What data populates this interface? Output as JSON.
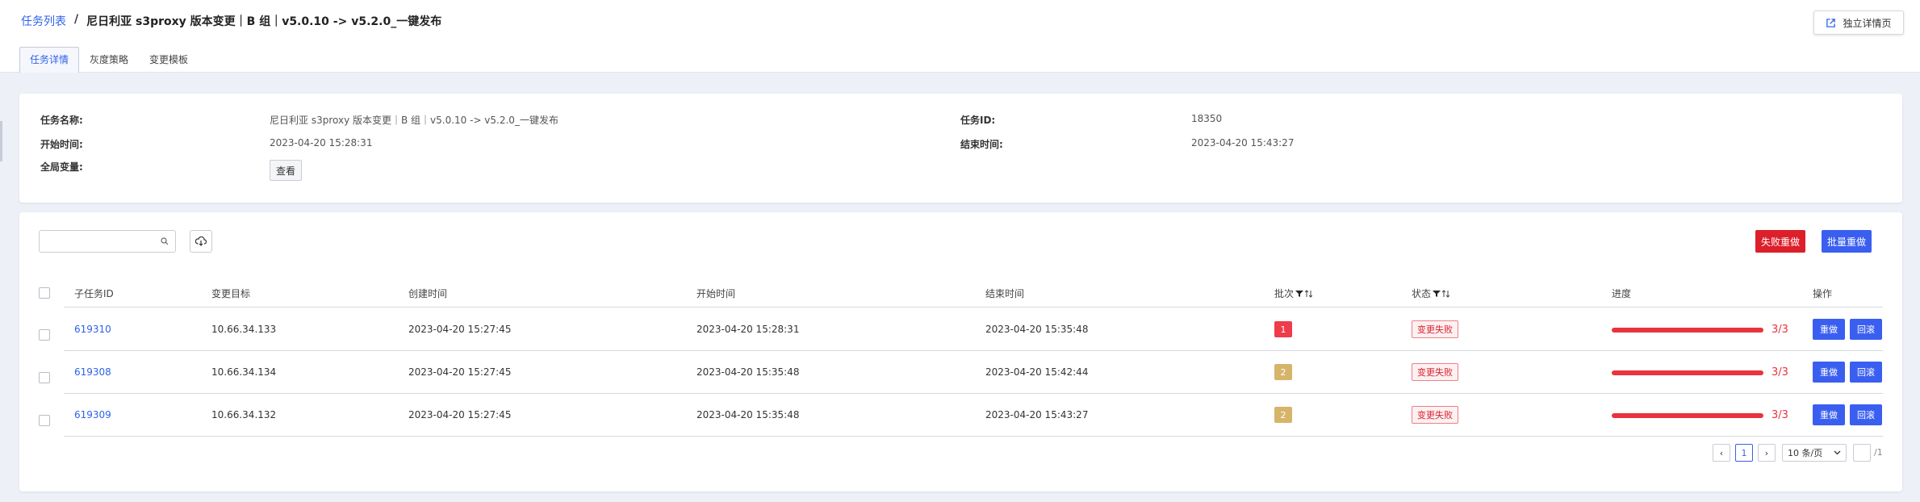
{
  "breadcrumb": {
    "root": "任务列表",
    "sep": "/",
    "current": "尼日利亚 s3proxy 版本变更｜B 组｜v5.0.10 -> v5.2.0_一键发布"
  },
  "header": {
    "standalone_label": "独立详情页"
  },
  "tabs": [
    {
      "label": "任务详情",
      "active": true
    },
    {
      "label": "灰度策略",
      "active": false
    },
    {
      "label": "变更模板",
      "active": false
    }
  ],
  "info": {
    "task_name_label": "任务名称:",
    "task_name_value": "尼日利亚 s3proxy 版本变更｜B 组｜v5.0.10 -> v5.2.0_一键发布",
    "task_id_label": "任务ID:",
    "task_id_value": "18350",
    "start_label": "开始时间:",
    "start_value": "2023-04-20 15:28:31",
    "end_label": "结束时间:",
    "end_value": "2023-04-20 15:43:27",
    "global_label": "全局变量:",
    "view_label": "查看"
  },
  "toolbar": {
    "search_placeholder": "",
    "retry_failed_label": "失败重做",
    "batch_retry_label": "批量重做"
  },
  "table": {
    "headers": {
      "subtask_id": "子任务ID",
      "target": "变更目标",
      "created": "创建时间",
      "start": "开始时间",
      "end": "结束时间",
      "batch": "批次",
      "status": "状态",
      "progress": "进度",
      "ops": "操作"
    },
    "rows": [
      {
        "id": "619310",
        "target": "10.66.34.133",
        "created": "2023-04-20 15:27:45",
        "start": "2023-04-20 15:28:31",
        "end": "2023-04-20 15:35:48",
        "batch": "1",
        "batch_color": "#ef3b4a",
        "status": "变更失败",
        "progress": 1.0,
        "progress_text": "3/3",
        "redo": "重做",
        "rollback": "回滚"
      },
      {
        "id": "619308",
        "target": "10.66.34.134",
        "created": "2023-04-20 15:27:45",
        "start": "2023-04-20 15:35:48",
        "end": "2023-04-20 15:42:44",
        "batch": "2",
        "batch_color": "#d6b46a",
        "status": "变更失败",
        "progress": 1.0,
        "progress_text": "3/3",
        "redo": "重做",
        "rollback": "回滚"
      },
      {
        "id": "619309",
        "target": "10.66.34.132",
        "created": "2023-04-20 15:27:45",
        "start": "2023-04-20 15:35:48",
        "end": "2023-04-20 15:43:27",
        "batch": "2",
        "batch_color": "#d6b46a",
        "status": "变更失败",
        "progress": 1.0,
        "progress_text": "3/3",
        "redo": "重做",
        "rollback": "回滚"
      }
    ]
  },
  "pagination": {
    "prev": "‹",
    "current": "1",
    "next": "›",
    "page_size": "10 条/页",
    "total": "/1"
  },
  "colors": {
    "accent": "#3a5ff0",
    "danger": "#dc1f2a",
    "link": "#2f62ea"
  }
}
